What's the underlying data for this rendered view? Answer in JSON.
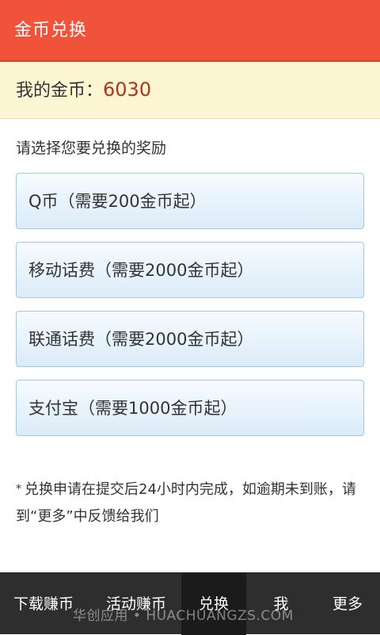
{
  "header": {
    "title": "金币兑换"
  },
  "coins": {
    "label": "我的金币：",
    "value": "6030"
  },
  "prompt": "请选择您要兑换的奖励",
  "options": [
    {
      "label": "Q币（需要200金币起）"
    },
    {
      "label": "移动话费（需要2000金币起）"
    },
    {
      "label": "联通话费（需要2000金币起）"
    },
    {
      "label": "支付宝（需要1000金币起）"
    }
  ],
  "notice": {
    "star": "*",
    "text": "兑换申请在提交后24小时内完成，如逾期未到账，请到“更多”中反馈给我们"
  },
  "tabs": [
    {
      "label": "下载赚币"
    },
    {
      "label": "活动赚币"
    },
    {
      "label": "兑换",
      "active": true
    },
    {
      "label": "我"
    },
    {
      "label": "更多"
    }
  ],
  "watermark": "华创应用 • HUACHUANGZS.COM",
  "colors": {
    "header": "#f0533a",
    "coin_value": "#b5311e",
    "tabbar": "#2e2e2e"
  }
}
